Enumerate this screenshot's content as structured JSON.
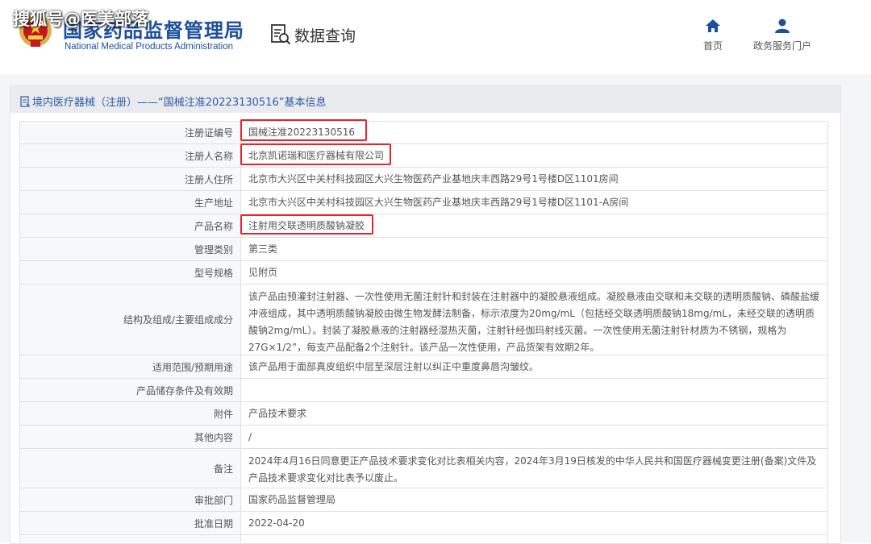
{
  "watermark": "搜狐号@医美部落",
  "header": {
    "logo_cn": "国家药品监督管理局",
    "logo_en": "National Medical Products Administration",
    "section": "数据查询",
    "nav": [
      {
        "label": "首页",
        "icon": "home-icon"
      },
      {
        "label": "政务服务门户",
        "icon": "user-icon"
      }
    ]
  },
  "panel": {
    "title": "境内医疗器械（注册）——“国械注准20223130516”基本信息"
  },
  "highlight_color": "#e8232a",
  "rows": [
    {
      "label": "注册证编号",
      "value": "国械注准20223130516"
    },
    {
      "label": "注册人名称",
      "value": "北京凯诺瑞和医疗器械有限公司"
    },
    {
      "label": "注册人住所",
      "value": "北京市大兴区中关村科技园区大兴生物医药产业基地庆丰西路29号1号楼D区1101房间"
    },
    {
      "label": "生产地址",
      "value": "北京市大兴区中关村科技园区大兴生物医药产业基地庆丰西路29号1号楼D区1101-A房间"
    },
    {
      "label": "产品名称",
      "value": "注射用交联透明质酸钠凝胶"
    },
    {
      "label": "管理类别",
      "value": "第三类"
    },
    {
      "label": "型号规格",
      "value": "见附页"
    },
    {
      "label": "结构及组成/主要组成成分",
      "value": "该产品由预灌封注射器、一次性使用无菌注射针和封装在注射器中的凝胶悬液组成。凝胶悬液由交联和未交联的透明质酸钠、磷酸盐缓冲液组成，其中透明质酸钠凝胶由微生物发酵法制备，标示浓度为20mg/mL（包括经交联透明质酸钠18mg/mL，未经交联的透明质酸钠2mg/mL）。封装了凝胶悬液的注射器经湿热灭菌，注射针经伽玛射线灭菌。一次性使用无菌注射针材质为不锈钢，规格为27G×1/2”，每支产品配备2个注射针。该产品一次性使用，产品货架有效期2年。"
    },
    {
      "label": "适用范围/预期用途",
      "value": "该产品用于面部真皮组织中层至深层注射以纠正中重度鼻唇沟皱纹。"
    },
    {
      "label": "产品储存条件及有效期",
      "value": ""
    },
    {
      "label": "附件",
      "value": "产品技术要求"
    },
    {
      "label": "其他内容",
      "value": "/"
    },
    {
      "label": "备注",
      "value": "2024年4月16日同意更正产品技术要求变化对比表相关内容，2024年3月19日核发的中华人民共和国医疗器械变更注册(备案)文件及产品技术要求变化对比表予以废止。"
    },
    {
      "label": "审批部门",
      "value": "国家药品监督管理局"
    },
    {
      "label": "批准日期",
      "value": "2022-04-20"
    }
  ]
}
